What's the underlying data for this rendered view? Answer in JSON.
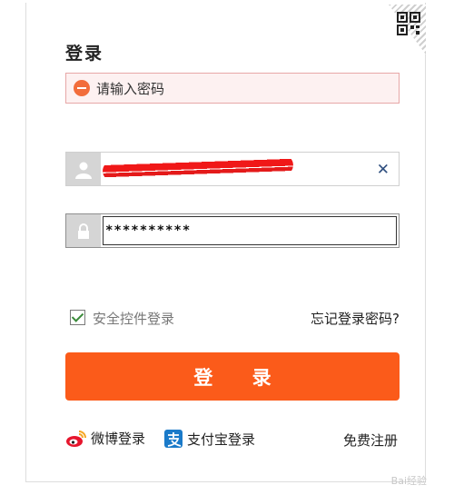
{
  "form": {
    "title": "登录",
    "error_message": "请输入密码",
    "username_value": "",
    "password_value": "**********"
  },
  "options": {
    "security_login_label": "安全控件登录",
    "security_login_checked": true,
    "forgot_password_label": "忘记登录密码?"
  },
  "actions": {
    "login_button_label": "登 录"
  },
  "footer": {
    "weibo_login_label": "微博登录",
    "alipay_login_label": "支付宝登录",
    "register_label": "免费注册"
  },
  "watermark": {
    "text": "Bai经验"
  },
  "icons": {
    "error": "error-minus-icon",
    "user": "user-icon",
    "lock": "lock-icon",
    "clear": "clear-icon",
    "qr": "qr-code-icon",
    "weibo": "weibo-icon",
    "alipay": "alipay-icon"
  },
  "colors": {
    "accent": "#fb5b1a",
    "error_bg": "#fdf1f1",
    "error_border": "#e7a7a7"
  }
}
